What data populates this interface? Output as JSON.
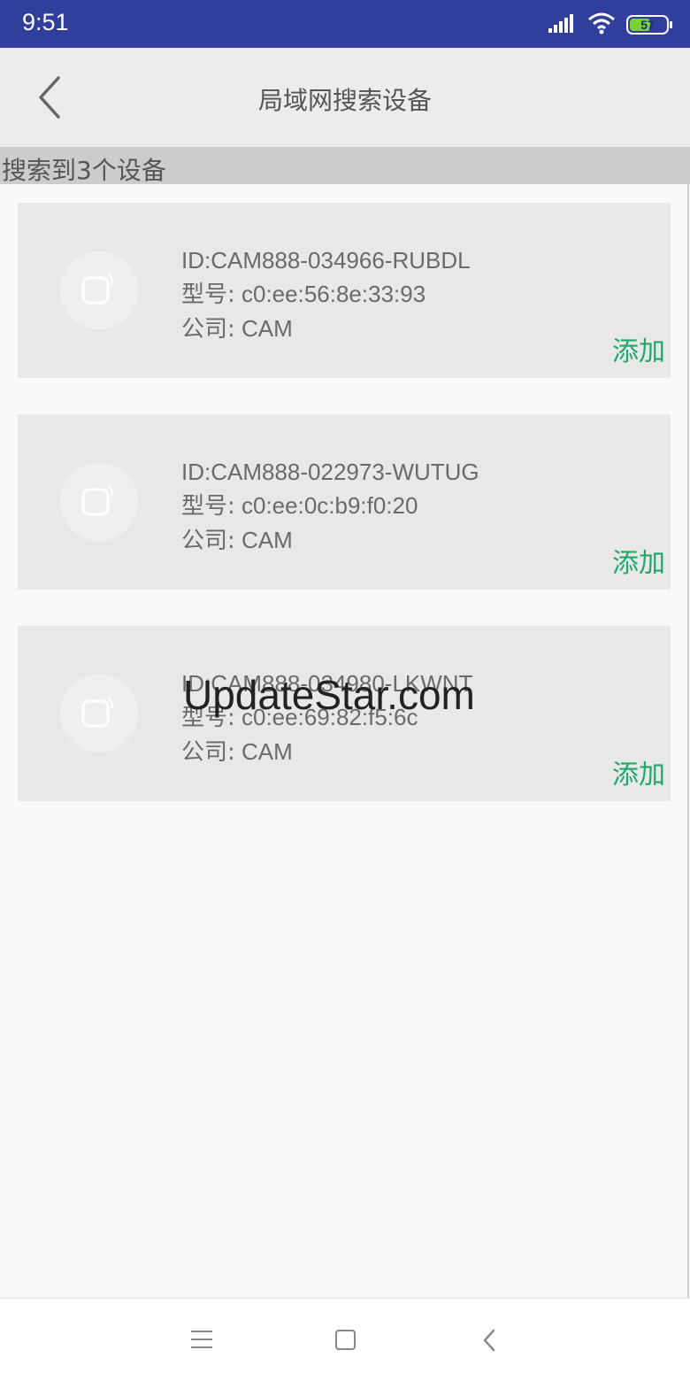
{
  "status_bar": {
    "time": "9:51",
    "battery_level": "57",
    "battery_color": "#7ad03a",
    "signal_icon": "cellular-signal-icon",
    "wifi_icon": "wifi-icon"
  },
  "header": {
    "title": "局域网搜索设备",
    "back_icon": "chevron-left-icon"
  },
  "result_summary": "搜索到3个设备",
  "devices": [
    {
      "id_text": "ID:CAM888-034966-RUBDL",
      "model_label": "型号:",
      "model_value": " c0:ee:56:8e:33:93",
      "company_label": "公司:",
      "company_value": " CAM",
      "add_label": "添加",
      "icon": "camera-device-icon"
    },
    {
      "id_text": "ID:CAM888-022973-WUTUG",
      "model_label": "型号:",
      "model_value": " c0:ee:0c:b9:f0:20",
      "company_label": "公司:",
      "company_value": " CAM",
      "add_label": "添加",
      "icon": "camera-device-icon"
    },
    {
      "id_text": "ID:CAM888-034980-LKWNT",
      "model_label": "型号:",
      "model_value": " c0:ee:69:82:f5:6c",
      "company_label": "公司:",
      "company_value": " CAM",
      "add_label": "添加",
      "icon": "camera-device-icon"
    }
  ],
  "watermark": "UpdateStar.com",
  "nav_bar": {
    "menu_icon": "menu-icon",
    "home_icon": "home-square-icon",
    "back_icon": "back-triangle-icon"
  },
  "colors": {
    "status_bar": "#2f3f9b",
    "accent_green": "#1fa86a"
  }
}
